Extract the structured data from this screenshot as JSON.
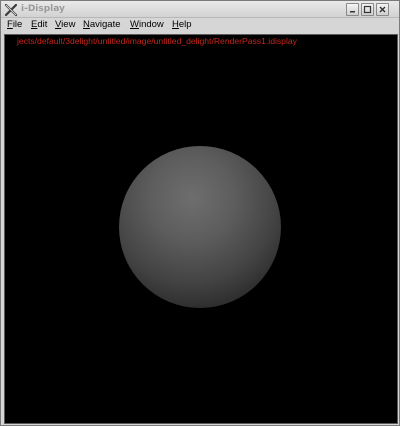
{
  "window": {
    "title": "i-Display"
  },
  "menu": {
    "items": [
      {
        "label_rest": "ile",
        "underline": "F"
      },
      {
        "label_rest": "dit",
        "underline": "E"
      },
      {
        "label_rest": "iew",
        "underline": "V"
      },
      {
        "label_rest": "avigate",
        "underline": "N"
      },
      {
        "label_rest": "indow",
        "underline": "W"
      },
      {
        "label_rest": "elp",
        "underline": "H"
      }
    ]
  },
  "viewport": {
    "path": "jects/default/3delight/untitled/image/untitled_delight/RenderPass1.idisplay",
    "path_color": "#c8261c",
    "background": "#000000"
  },
  "icons": {
    "app": "x-logo-icon",
    "minimize": "minimize-icon",
    "maximize": "maximize-icon",
    "close": "close-icon"
  }
}
